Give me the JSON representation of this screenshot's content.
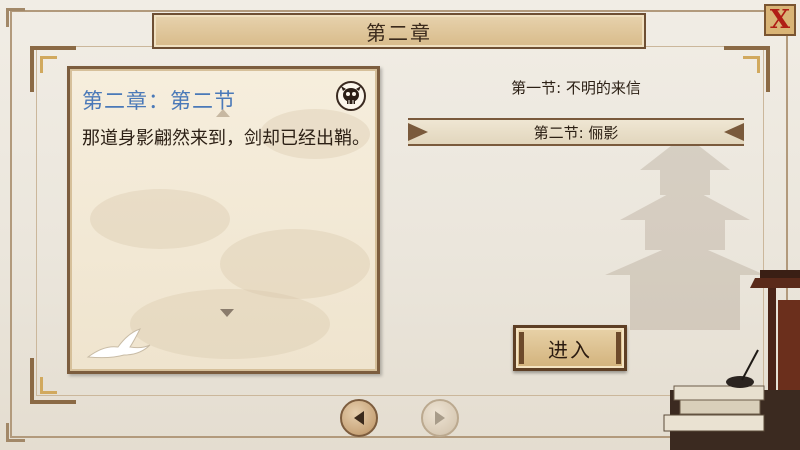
{
  "header": {
    "title": "第二章"
  },
  "close_button": {
    "label": "X"
  },
  "story_card": {
    "title": "第二章：第二节",
    "text": "那道身影翩然来到，剑却已经出鞘。"
  },
  "sections": [
    {
      "label": "第一节: 不明的来信",
      "selected": false
    },
    {
      "label": "第二节: 俪影",
      "selected": true
    }
  ],
  "enter_button": {
    "label": "进入"
  },
  "pagination": {
    "prev_enabled": true,
    "next_enabled": false
  },
  "icons": {
    "close": "close-x-icon",
    "emblem": "skull-emblem-icon",
    "scroll_up": "triangle-up-icon",
    "scroll_down": "triangle-down-icon",
    "bird": "crane-bird-icon",
    "prev": "left-arrow-icon",
    "next": "right-arrow-icon"
  },
  "colors": {
    "title_blue": "#4a79b8",
    "close_red": "#b01e16",
    "frame_brown": "#7c5d3e"
  }
}
